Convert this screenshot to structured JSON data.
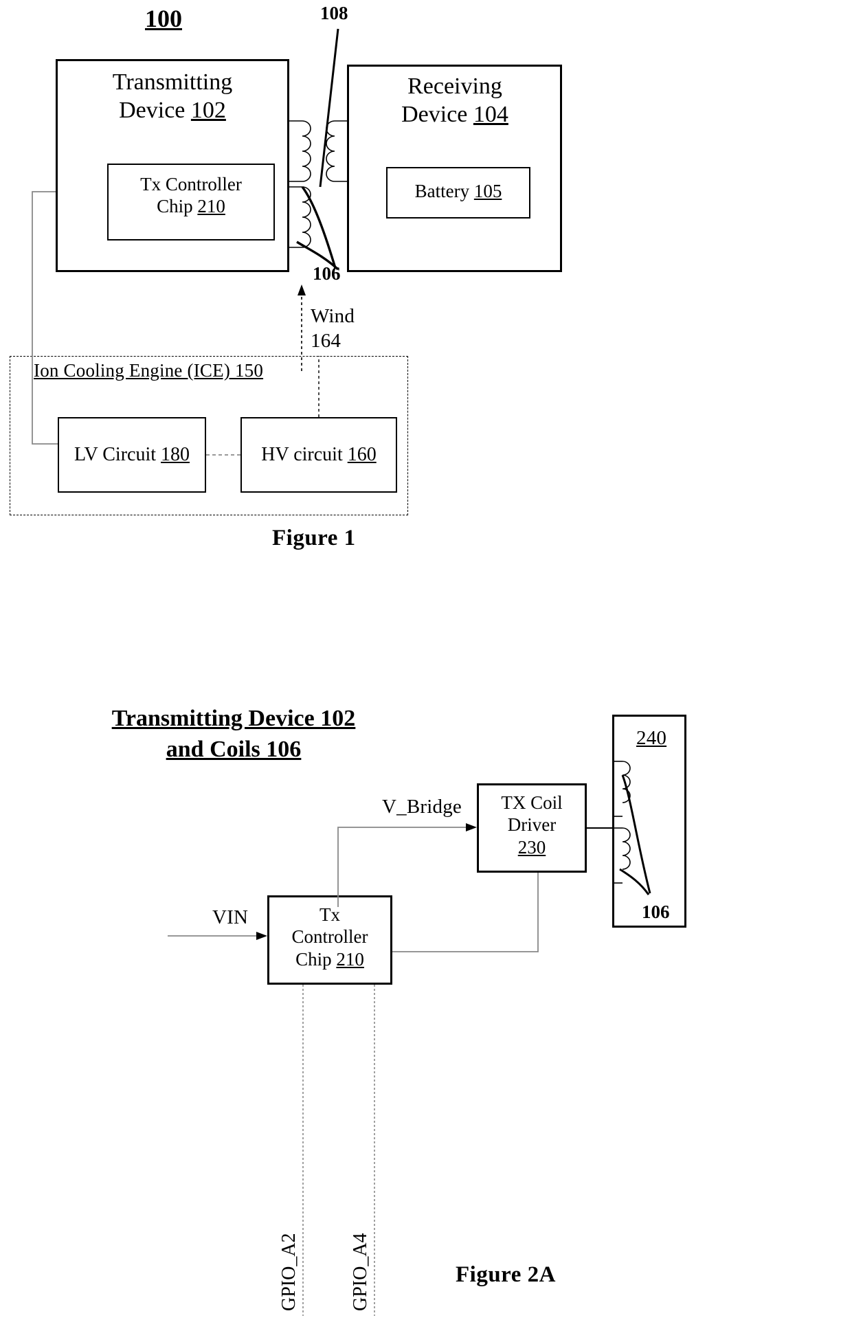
{
  "figure1": {
    "system_label": "100",
    "transmitting_device": {
      "line1": "Transmitting",
      "line2_text": "Device ",
      "line2_num": "102",
      "inner_chip": {
        "line1": "Tx Controller",
        "line2_text": "Chip ",
        "line2_num": "210"
      }
    },
    "receiving_device": {
      "line1": "Receiving",
      "line2_text": "Device ",
      "line2_num": "104",
      "inner_battery": {
        "text": "Battery ",
        "num": "105"
      }
    },
    "coil_labels": {
      "coupling": "108",
      "coils": "106"
    },
    "wind": {
      "line1": "Wind",
      "line2": "164"
    },
    "ice": {
      "title": "Ion Cooling Engine (ICE) 150",
      "lv_circuit": {
        "text": "LV  Circuit ",
        "num": "180"
      },
      "hv_circuit": {
        "text": "HV circuit ",
        "num": "160"
      }
    },
    "caption": "Figure 1"
  },
  "figure2a": {
    "title_line1": "Transmitting Device 102",
    "title_line2": "and Coils 106",
    "signals": {
      "v_bridge": "V_Bridge",
      "vin": "VIN",
      "gpio_a2": "GPIO_A2",
      "gpio_a4": "GPIO_A4"
    },
    "tx_coil_driver": {
      "line1": "TX Coil",
      "line2": "Driver",
      "num": "230"
    },
    "tx_controller_chip": {
      "line1": "Tx",
      "line2": "Controller",
      "line3_text": "Chip ",
      "line3_num": "210"
    },
    "coil_block": {
      "num_top": "240",
      "num_bottom": "106"
    },
    "caption": "Figure 2A"
  },
  "colors": {
    "ink": "#000000",
    "paper": "#ffffff",
    "faint_line": "#777777"
  }
}
